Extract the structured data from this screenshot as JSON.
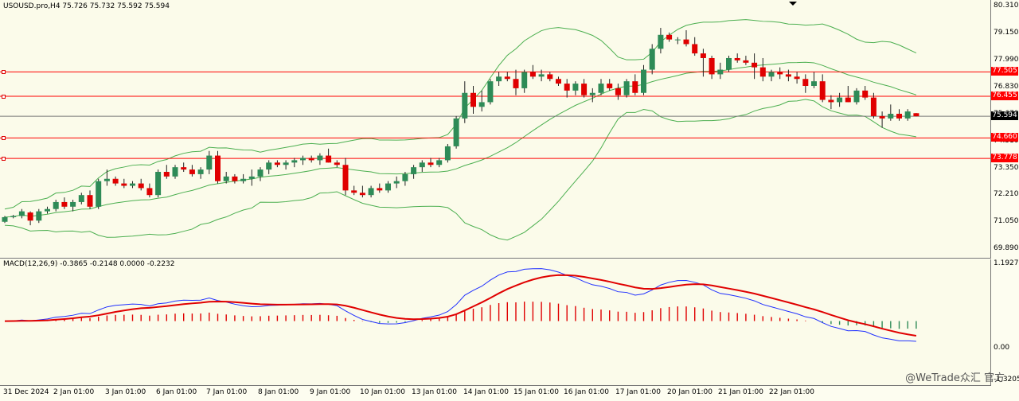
{
  "header": {
    "symbol_text": "USOUSD.pro,H4  75.726 75.732 75.592 75.594"
  },
  "macd_header": {
    "text": "MACD(12,26,9) -0.3865 -0.2148 0.0000 -0.2232"
  },
  "price_axis": [
    "80.310",
    "79.150",
    "77.990",
    "76.830",
    "75.670",
    "74.510",
    "73.350",
    "72.210",
    "71.050",
    "69.890"
  ],
  "levels": [
    {
      "label": "77.505",
      "kind": "resistance"
    },
    {
      "label": "76.455",
      "kind": "resistance"
    },
    {
      "label": "75.594",
      "kind": "current"
    },
    {
      "label": "74.660",
      "kind": "support"
    },
    {
      "label": "73.778",
      "kind": "support"
    }
  ],
  "macd_axis": [
    "1.1927",
    "0.00",
    "-1.3205"
  ],
  "date_labels": [
    "31 Dec 2024",
    "2 Jan 01:00",
    "3 Jan 01:00",
    "6 Jan 01:00",
    "7 Jan 01:00",
    "8 Jan 01:00",
    "9 Jan 01:00",
    "10 Jan 01:00",
    "13 Jan 01:00",
    "14 Jan 01:00",
    "15 Jan 01:00",
    "16 Jan 01:00",
    "17 Jan 01:00",
    "20 Jan 01:00",
    "21 Jan 01:00",
    "22 Jan 01:00"
  ],
  "watermark": "@WeTrade众汇 官方",
  "colors": {
    "bull": "#2e8b57",
    "bear": "#e00000",
    "bands": "#4caf50",
    "macd_line": "#2030ff",
    "signal_line": "#e00000",
    "level_line": "#ff0000"
  },
  "chart_data": {
    "type": "candlestick",
    "ylim": [
      69.5,
      80.6
    ],
    "candles": [
      [
        71.05,
        71.3,
        71.0,
        71.25
      ],
      [
        71.25,
        71.35,
        71.2,
        71.3
      ],
      [
        71.3,
        71.6,
        71.2,
        71.5
      ],
      [
        71.45,
        71.5,
        70.9,
        71.1
      ],
      [
        71.1,
        71.6,
        71.0,
        71.5
      ],
      [
        71.5,
        71.7,
        71.4,
        71.6
      ],
      [
        71.6,
        72.0,
        71.5,
        71.9
      ],
      [
        71.9,
        72.1,
        71.6,
        71.7
      ],
      [
        71.7,
        72.0,
        71.5,
        71.9
      ],
      [
        71.9,
        72.3,
        71.8,
        72.2
      ],
      [
        72.2,
        72.4,
        71.6,
        71.7
      ],
      [
        71.7,
        72.9,
        71.6,
        72.8
      ],
      [
        72.8,
        73.3,
        72.6,
        72.9
      ],
      [
        72.9,
        73.0,
        72.6,
        72.7
      ],
      [
        72.7,
        72.9,
        72.5,
        72.6
      ],
      [
        72.6,
        72.8,
        72.5,
        72.7
      ],
      [
        72.7,
        72.9,
        72.4,
        72.5
      ],
      [
        72.5,
        72.7,
        72.1,
        72.2
      ],
      [
        72.2,
        73.3,
        72.1,
        73.2
      ],
      [
        73.2,
        73.5,
        72.9,
        73.0
      ],
      [
        73.0,
        73.5,
        72.9,
        73.4
      ],
      [
        73.4,
        73.6,
        73.2,
        73.3
      ],
      [
        73.3,
        73.5,
        73.0,
        73.1
      ],
      [
        73.1,
        73.4,
        72.9,
        73.3
      ],
      [
        73.3,
        74.1,
        73.1,
        73.9
      ],
      [
        73.9,
        74.1,
        72.7,
        72.8
      ],
      [
        72.8,
        73.2,
        72.7,
        73.0
      ],
      [
        73.0,
        73.1,
        72.7,
        72.8
      ],
      [
        72.8,
        73.1,
        72.7,
        72.9
      ],
      [
        72.9,
        73.3,
        72.6,
        73.0
      ],
      [
        73.0,
        73.4,
        72.8,
        73.3
      ],
      [
        73.3,
        73.7,
        73.1,
        73.6
      ],
      [
        73.6,
        73.7,
        73.4,
        73.5
      ],
      [
        73.5,
        73.7,
        73.3,
        73.6
      ],
      [
        73.6,
        73.8,
        73.4,
        73.7
      ],
      [
        73.7,
        73.9,
        73.5,
        73.8
      ],
      [
        73.8,
        73.9,
        73.6,
        73.7
      ],
      [
        73.7,
        74.0,
        73.5,
        73.9
      ],
      [
        73.9,
        74.2,
        73.6,
        73.6
      ],
      [
        73.6,
        73.7,
        73.4,
        73.5
      ],
      [
        73.5,
        73.8,
        72.2,
        72.4
      ],
      [
        72.4,
        72.6,
        72.2,
        72.3
      ],
      [
        72.3,
        72.6,
        72.1,
        72.2
      ],
      [
        72.2,
        72.6,
        72.1,
        72.5
      ],
      [
        72.5,
        72.7,
        72.3,
        72.4
      ],
      [
        72.4,
        72.8,
        72.3,
        72.7
      ],
      [
        72.7,
        73.0,
        72.5,
        72.8
      ],
      [
        72.8,
        73.2,
        72.6,
        73.1
      ],
      [
        73.1,
        73.5,
        72.9,
        73.4
      ],
      [
        73.4,
        73.7,
        73.2,
        73.6
      ],
      [
        73.6,
        73.8,
        73.4,
        73.5
      ],
      [
        73.5,
        73.8,
        73.4,
        73.7
      ],
      [
        73.7,
        74.4,
        73.6,
        74.3
      ],
      [
        74.3,
        75.6,
        74.2,
        75.5
      ],
      [
        75.5,
        77.1,
        75.3,
        76.6
      ],
      [
        76.6,
        76.9,
        75.7,
        76.0
      ],
      [
        76.0,
        76.7,
        75.8,
        76.2
      ],
      [
        76.2,
        77.2,
        76.1,
        77.1
      ],
      [
        77.1,
        77.5,
        76.9,
        77.3
      ],
      [
        77.3,
        77.5,
        77.1,
        77.2
      ],
      [
        77.2,
        77.6,
        76.5,
        76.8
      ],
      [
        76.8,
        77.6,
        76.6,
        77.5
      ],
      [
        77.5,
        77.8,
        77.2,
        77.3
      ],
      [
        77.3,
        77.6,
        77.1,
        77.4
      ],
      [
        77.4,
        77.5,
        77.1,
        77.2
      ],
      [
        77.2,
        77.3,
        76.9,
        77.0
      ],
      [
        77.0,
        77.2,
        76.4,
        76.7
      ],
      [
        76.7,
        77.1,
        76.5,
        77.0
      ],
      [
        77.0,
        77.2,
        76.4,
        76.5
      ],
      [
        76.5,
        76.8,
        76.2,
        76.6
      ],
      [
        76.6,
        77.2,
        76.5,
        77.0
      ],
      [
        77.0,
        77.2,
        76.7,
        76.8
      ],
      [
        76.8,
        77.0,
        76.3,
        76.5
      ],
      [
        76.5,
        77.2,
        76.4,
        77.1
      ],
      [
        77.1,
        77.4,
        76.5,
        76.6
      ],
      [
        76.6,
        77.8,
        76.5,
        77.6
      ],
      [
        77.6,
        78.7,
        77.4,
        78.5
      ],
      [
        78.5,
        79.4,
        78.3,
        79.1
      ],
      [
        79.1,
        79.2,
        78.8,
        78.9
      ],
      [
        78.9,
        79.0,
        78.7,
        78.9
      ],
      [
        78.9,
        79.3,
        78.6,
        78.7
      ],
      [
        78.7,
        79.0,
        78.2,
        78.3
      ],
      [
        78.3,
        78.5,
        77.3,
        78.1
      ],
      [
        78.1,
        78.2,
        77.2,
        77.4
      ],
      [
        77.4,
        77.9,
        77.2,
        77.6
      ],
      [
        77.6,
        78.2,
        77.5,
        78.1
      ],
      [
        78.1,
        78.3,
        77.9,
        78.0
      ],
      [
        78.0,
        78.2,
        77.8,
        77.9
      ],
      [
        77.9,
        78.3,
        77.2,
        77.7
      ],
      [
        77.7,
        78.1,
        77.1,
        77.3
      ],
      [
        77.3,
        77.6,
        77.1,
        77.5
      ],
      [
        77.5,
        77.7,
        77.2,
        77.4
      ],
      [
        77.4,
        77.6,
        77.1,
        77.3
      ],
      [
        77.3,
        77.5,
        77.0,
        77.2
      ],
      [
        77.2,
        77.4,
        76.6,
        76.9
      ],
      [
        76.9,
        77.5,
        76.8,
        77.1
      ],
      [
        77.1,
        77.4,
        76.2,
        76.3
      ],
      [
        76.3,
        76.5,
        75.9,
        76.2
      ],
      [
        76.2,
        76.6,
        76.0,
        76.4
      ],
      [
        76.4,
        76.9,
        76.2,
        76.2
      ],
      [
        76.2,
        76.8,
        76.1,
        76.7
      ],
      [
        76.7,
        76.9,
        76.3,
        76.4
      ],
      [
        76.4,
        76.6,
        75.5,
        75.6
      ],
      [
        75.6,
        75.8,
        75.1,
        75.5
      ],
      [
        75.5,
        76.1,
        75.4,
        75.7
      ],
      [
        75.7,
        75.9,
        75.4,
        75.5
      ],
      [
        75.5,
        75.9,
        75.4,
        75.8
      ],
      [
        75.726,
        75.732,
        75.592,
        75.594
      ]
    ]
  },
  "macd_data": {
    "ylim": [
      -1.4,
      1.35
    ]
  }
}
